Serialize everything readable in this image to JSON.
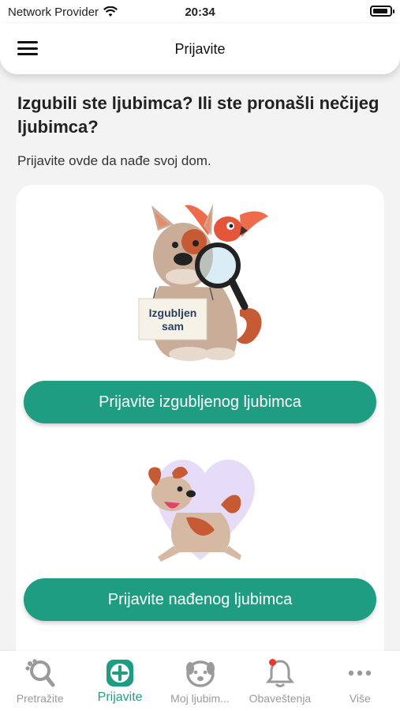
{
  "status_bar": {
    "carrier": "Network Provider",
    "time": "20:34"
  },
  "header": {
    "title": "Prijavite",
    "menu_icon": "hamburger-menu-icon"
  },
  "main": {
    "headline": "Izgubili ste ljubimca? Ili ste pronašli nečijeg ljubimca?",
    "subtitle": "Prijavite ovde da nađe svoj dom.",
    "lost_sign_line1": "Izgubljen",
    "lost_sign_line2": "sam",
    "lost_button_label": "Prijavite izgubljenog ljubimca",
    "found_button_label": "Prijavite nađenog ljubimca"
  },
  "tabbar": {
    "tabs": [
      {
        "label": "Pretražite",
        "icon": "search-paw-icon",
        "active": false
      },
      {
        "label": "Prijavite",
        "icon": "add-square-icon",
        "active": true
      },
      {
        "label": "Moj ljubim...",
        "icon": "dog-face-icon",
        "active": false
      },
      {
        "label": "Obaveštenja",
        "icon": "bell-icon",
        "active": false,
        "badge": true
      },
      {
        "label": "Više",
        "icon": "more-dots-icon",
        "active": false
      }
    ]
  },
  "colors": {
    "accent": "#1f9d83",
    "inactive": "#9a9a9a",
    "badge": "#e53935"
  }
}
